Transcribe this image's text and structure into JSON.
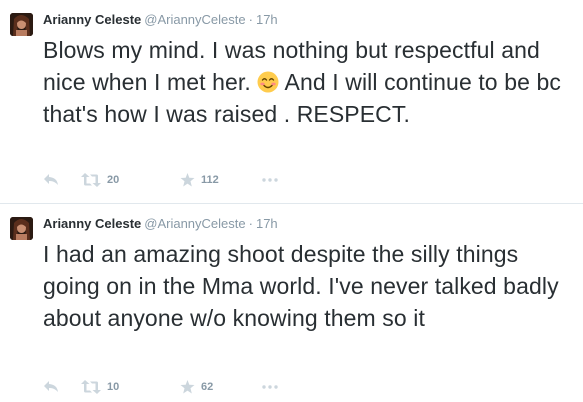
{
  "tweets": [
    {
      "fullname": "Arianny Celeste",
      "username": "@AriannyCeleste",
      "separator": "·",
      "time": "17h",
      "text_before_emoji": "Blows my mind. I was nothing but respectful and nice when I met her. ",
      "emoji": "smiling-face-emoji",
      "text_after_emoji": " And I will continue to be bc that's how I was raised . RESPECT.",
      "retweets": "20",
      "favorites": "112"
    },
    {
      "fullname": "Arianny Celeste",
      "username": "@AriannyCeleste",
      "separator": "·",
      "time": "17h",
      "text": "I had an amazing shoot despite the silly things going on in the Mma world. I've never talked badly about anyone w/o knowing them so it",
      "retweets": "10",
      "favorites": "62"
    }
  ],
  "icons": {
    "reply": "reply-icon",
    "retweet": "retweet-icon",
    "favorite": "star-icon",
    "more": "more-icon"
  },
  "colors": {
    "text": "#292f33",
    "muted": "#8899a6",
    "icon": "#ccd6dd",
    "divider": "#e1e8ed"
  }
}
